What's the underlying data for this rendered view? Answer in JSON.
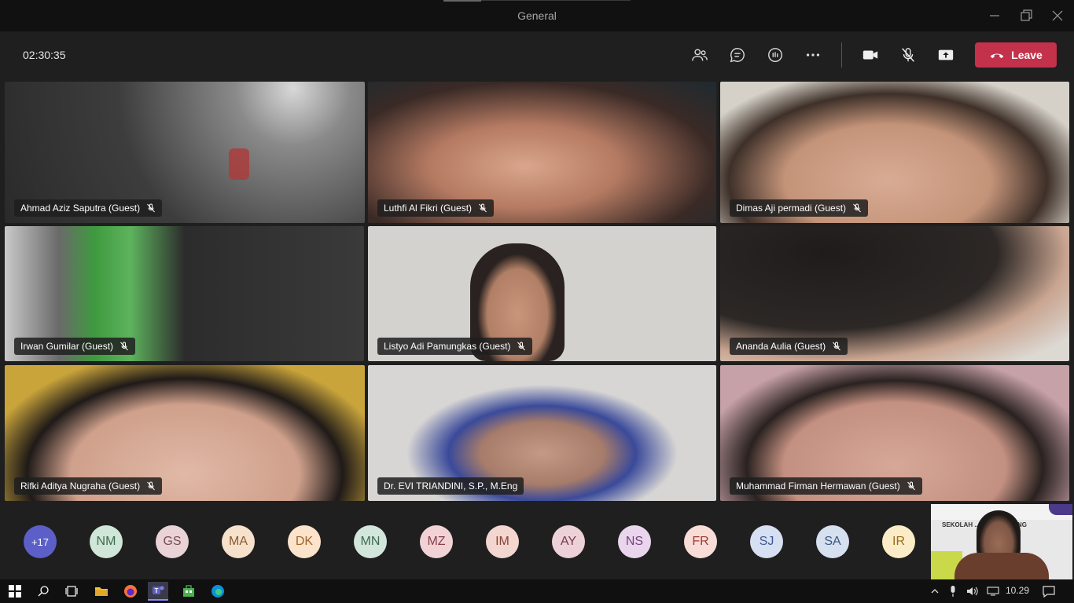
{
  "window": {
    "title": "General"
  },
  "toolbar": {
    "timer": "02:30:35",
    "leave_label": "Leave"
  },
  "tiles": [
    {
      "name": "Ahmad Aziz Saputra (Guest)"
    },
    {
      "name": "Luthfi Al Fikri (Guest)"
    },
    {
      "name": "Dimas Aji permadi (Guest)"
    },
    {
      "name": "Irwan Gumilar (Guest)"
    },
    {
      "name": "Listyo Adi Pamungkas (Guest)"
    },
    {
      "name": "Ananda Aulia (Guest)"
    },
    {
      "name": "Rifki Aditya Nugraha (Guest)"
    },
    {
      "name": "Dr. EVI TRIANDINI, S.P., M.Eng"
    },
    {
      "name": "Muhammad Firman Hermawan (Guest)"
    }
  ],
  "roster": {
    "overflow": "+17",
    "avatars": [
      "NM",
      "GS",
      "MA",
      "DK",
      "MN",
      "MZ",
      "IM",
      "AY",
      "NS",
      "FR",
      "SJ",
      "SA",
      "IR"
    ]
  },
  "selfview": {
    "banner_text": "SEKOLAH ... OGI BANDUNG"
  },
  "taskbar": {
    "clock": "10.29"
  },
  "colors": {
    "leave": "#c4314b",
    "overflow": "#5b5fc7"
  }
}
